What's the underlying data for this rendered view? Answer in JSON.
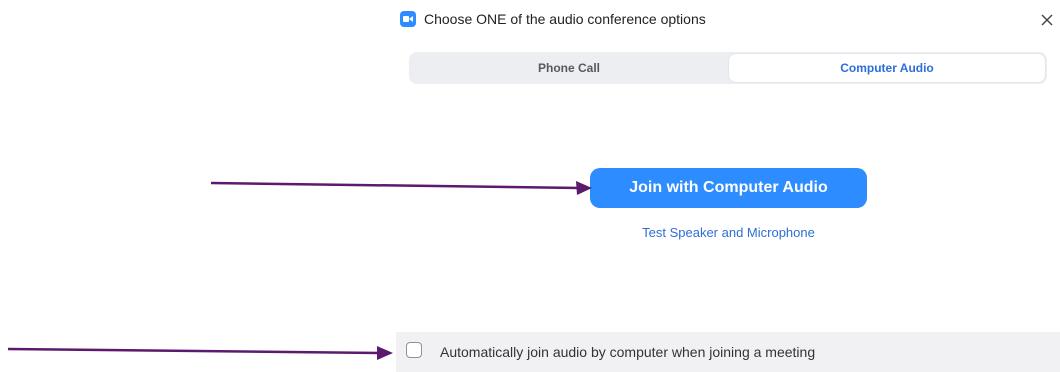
{
  "dialog": {
    "title": "Choose ONE of the audio conference options",
    "app_icon": "zoom-camera-icon",
    "close_icon": "close-icon"
  },
  "tabs": [
    {
      "label": "Phone Call",
      "selected": false
    },
    {
      "label": "Computer Audio",
      "selected": true
    }
  ],
  "main": {
    "join_button_label": "Join with Computer Audio",
    "test_link_label": "Test Speaker and Microphone"
  },
  "footer": {
    "auto_join_label": "Automatically join audio by computer when joining a meeting",
    "auto_join_checked": false
  },
  "annotations": {
    "arrow_color": "#5b1a6e"
  },
  "colors": {
    "accent": "#2d8cff",
    "link": "#2d6fd6"
  }
}
